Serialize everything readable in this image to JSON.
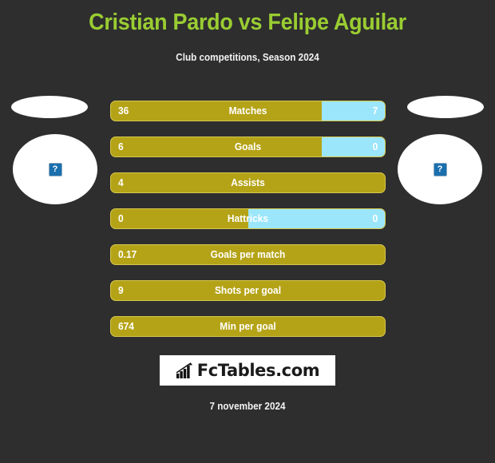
{
  "header": {
    "title": "Cristian Pardo vs Felipe Aguilar",
    "subtitle": "Club competitions, Season 2024",
    "title_color": "#9acd32",
    "background_color": "#2e2e2e"
  },
  "players": {
    "left": {
      "name": "Cristian Pardo",
      "image_status": "broken-image",
      "image_placeholder_glyph": "?"
    },
    "right": {
      "name": "Felipe Aguilar",
      "image_status": "broken-image",
      "image_placeholder_glyph": "?"
    }
  },
  "colors": {
    "left_bar": "#b5a317",
    "right_bar": "#9ce6fb",
    "bar_border": "#d6c84e",
    "text": "#ffffff"
  },
  "chart_data": {
    "type": "bar",
    "title": "Cristian Pardo vs Felipe Aguilar",
    "subtitle": "Club competitions, Season 2024",
    "orientation": "horizontal-diverging",
    "categories": [
      "Matches",
      "Goals",
      "Assists",
      "Hattricks",
      "Goals per match",
      "Shots per goal",
      "Min per goal"
    ],
    "series": [
      {
        "name": "Cristian Pardo",
        "color": "#b5a317",
        "values": [
          "36",
          "6",
          "4",
          "0",
          "0.17",
          "9",
          "674"
        ]
      },
      {
        "name": "Felipe Aguilar",
        "color": "#9ce6fb",
        "values": [
          "7",
          "0",
          null,
          "0",
          null,
          null,
          null
        ]
      }
    ],
    "left_fill_percent": [
      77,
      77,
      100,
      50,
      100,
      100,
      100
    ],
    "legend": "none",
    "grid": false
  },
  "rows": [
    {
      "label": "Matches",
      "left": "36",
      "right": "7",
      "left_pct": 77,
      "has_right": true
    },
    {
      "label": "Goals",
      "left": "6",
      "right": "0",
      "left_pct": 77,
      "has_right": true
    },
    {
      "label": "Assists",
      "left": "4",
      "right": "",
      "left_pct": 100,
      "has_right": false
    },
    {
      "label": "Hattricks",
      "left": "0",
      "right": "0",
      "left_pct": 50,
      "has_right": true
    },
    {
      "label": "Goals per match",
      "left": "0.17",
      "right": "",
      "left_pct": 100,
      "has_right": false
    },
    {
      "label": "Shots per goal",
      "left": "9",
      "right": "",
      "left_pct": 100,
      "has_right": false
    },
    {
      "label": "Min per goal",
      "left": "674",
      "right": "",
      "left_pct": 100,
      "has_right": false
    }
  ],
  "footer": {
    "logo_text": "FcTables.com",
    "logo_icon": "bar-chart-icon",
    "date": "7 november 2024"
  }
}
